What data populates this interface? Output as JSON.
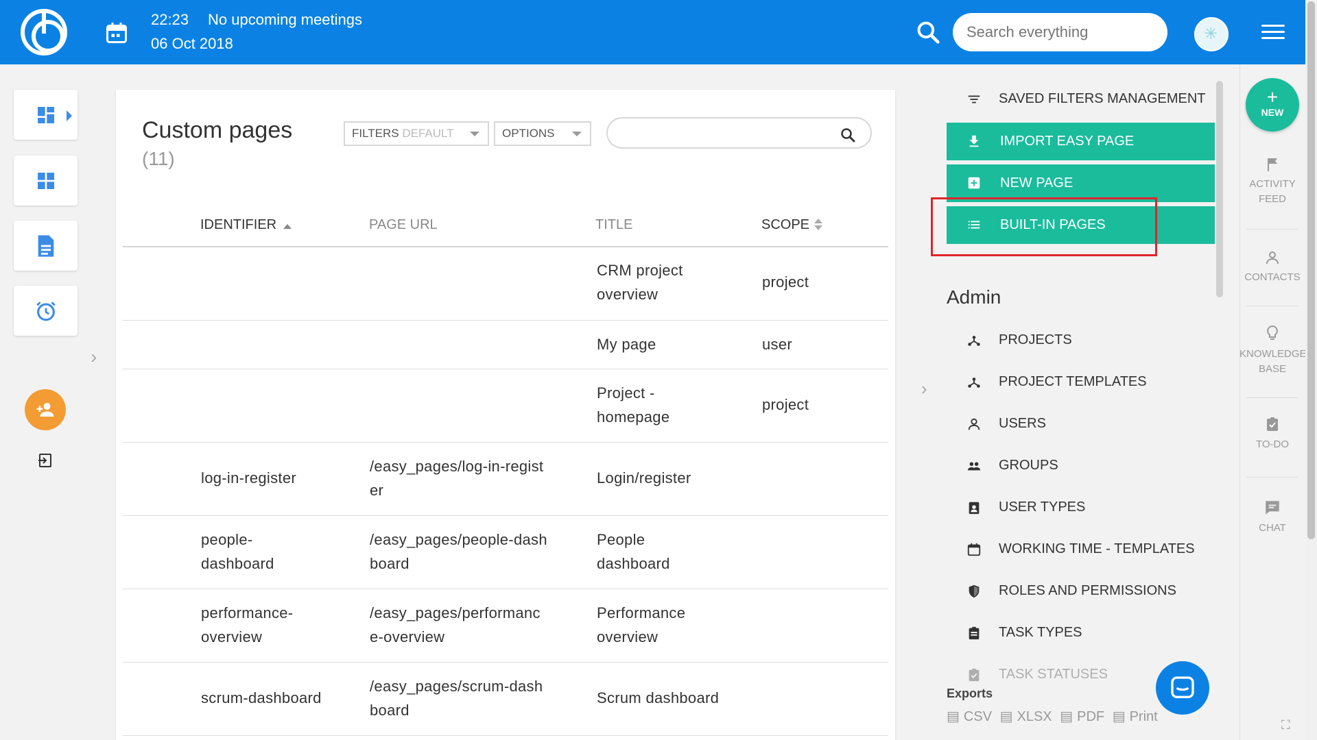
{
  "topbar": {
    "time": "22:23",
    "meetings": "No upcoming meetings",
    "date": "06 Oct 2018",
    "search_placeholder": "Search everything"
  },
  "main": {
    "title": "Custom pages",
    "count": "(11)",
    "filters_label": "FILTERS",
    "filters_value": "DEFAULT",
    "options_label": "OPTIONS",
    "columns": [
      "IDENTIFIER",
      "PAGE URL",
      "TITLE",
      "SCOPE"
    ],
    "rows": [
      {
        "identifier": [
          "",
          ""
        ],
        "url": [
          "",
          ""
        ],
        "title": [
          "CRM project",
          "overview"
        ],
        "scope": "project"
      },
      {
        "identifier": [
          "",
          ""
        ],
        "url": [
          "",
          ""
        ],
        "title": [
          "My page",
          ""
        ],
        "scope": "user"
      },
      {
        "identifier": [
          "",
          ""
        ],
        "url": [
          "",
          ""
        ],
        "title": [
          "Project -",
          "homepage"
        ],
        "scope": "project"
      },
      {
        "identifier": [
          "log-in-register",
          ""
        ],
        "url": [
          "/easy_pages/log-in-regist",
          "er"
        ],
        "title": [
          "Login/register",
          ""
        ],
        "scope": ""
      },
      {
        "identifier": [
          "people-",
          "dashboard"
        ],
        "url": [
          "/easy_pages/people-dash",
          "board"
        ],
        "title": [
          "People",
          "dashboard"
        ],
        "scope": ""
      },
      {
        "identifier": [
          "performance-",
          "overview"
        ],
        "url": [
          "/easy_pages/performanc",
          "e-overview"
        ],
        "title": [
          "Performance",
          "overview"
        ],
        "scope": ""
      },
      {
        "identifier": [
          "scrum-dashboard",
          ""
        ],
        "url": [
          "/easy_pages/scrum-dash",
          "board"
        ],
        "title": [
          "Scrum dashboard",
          ""
        ],
        "scope": ""
      }
    ]
  },
  "right_panel": {
    "saved_filters": "SAVED FILTERS MANAGEMENT",
    "import_page": "IMPORT EASY PAGE",
    "new_page": "NEW PAGE",
    "built_in_pages": "BUILT-IN PAGES",
    "admin_title": "Admin",
    "admin_items": [
      "PROJECTS",
      "PROJECT TEMPLATES",
      "USERS",
      "GROUPS",
      "USER TYPES",
      "WORKING TIME - TEMPLATES",
      "ROLES AND PERMISSIONS",
      "TASK TYPES",
      "TASK STATUSES"
    ],
    "exports_title": "Exports",
    "exports": [
      "CSV",
      "XLSX",
      "PDF",
      "Print"
    ],
    "accent": "#1abc9c",
    "highlight_color": "#e0242b"
  },
  "far_right": {
    "new_label": "NEW",
    "activity": [
      "ACTIVITY",
      "FEED"
    ],
    "contacts": "CONTACTS",
    "knowledge": [
      "KNOWLEDGE",
      "BASE"
    ],
    "todo": "TO-DO",
    "chat": "CHAT"
  },
  "colors": {
    "topbar": "#0b82e3",
    "orange": "#f39c34"
  }
}
